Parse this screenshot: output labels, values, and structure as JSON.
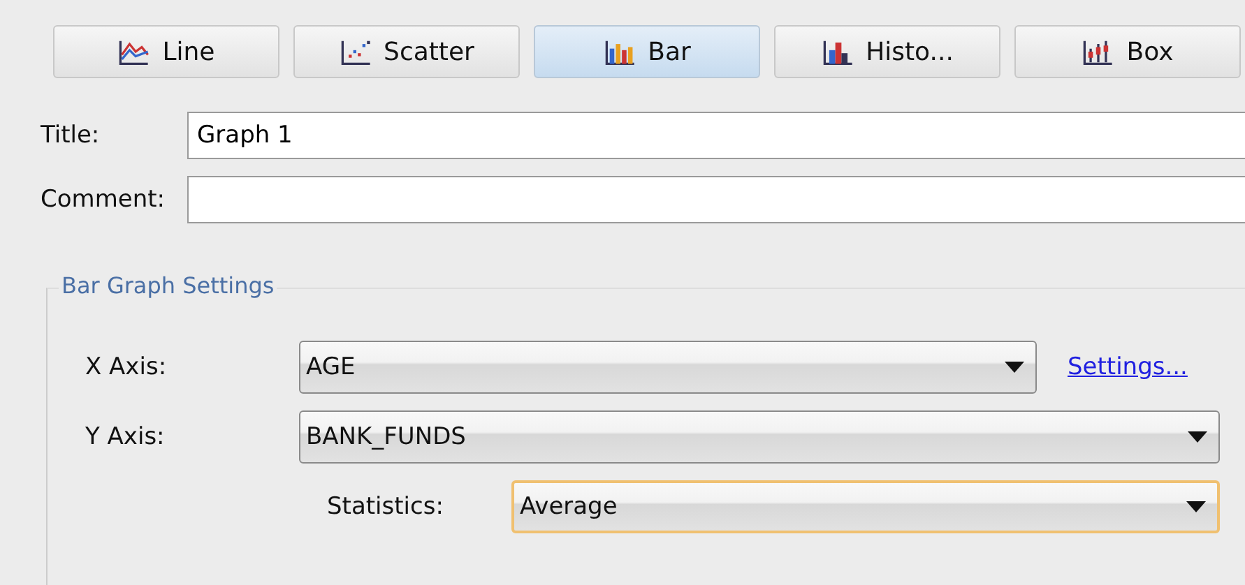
{
  "graph_types": [
    {
      "label": "Line",
      "kind": "line",
      "selected": false
    },
    {
      "label": "Scatter",
      "kind": "scatter",
      "selected": false
    },
    {
      "label": "Bar",
      "kind": "bar",
      "selected": true
    },
    {
      "label": "Histo...",
      "kind": "histogram",
      "selected": false
    },
    {
      "label": "Box",
      "kind": "box",
      "selected": false
    }
  ],
  "title": {
    "label": "Title:",
    "value": "Graph 1"
  },
  "comment": {
    "label": "Comment:"
  },
  "settings_group": {
    "title": "Bar Graph Settings",
    "x_axis": {
      "label": "X Axis:",
      "value": "AGE",
      "focused": false,
      "link": "Settings..."
    },
    "y_axis": {
      "label": "Y Axis:",
      "value": "BANK_FUNDS",
      "focused": false
    },
    "statistics": {
      "label": "Statistics:",
      "value": "Average",
      "focused": true
    }
  }
}
